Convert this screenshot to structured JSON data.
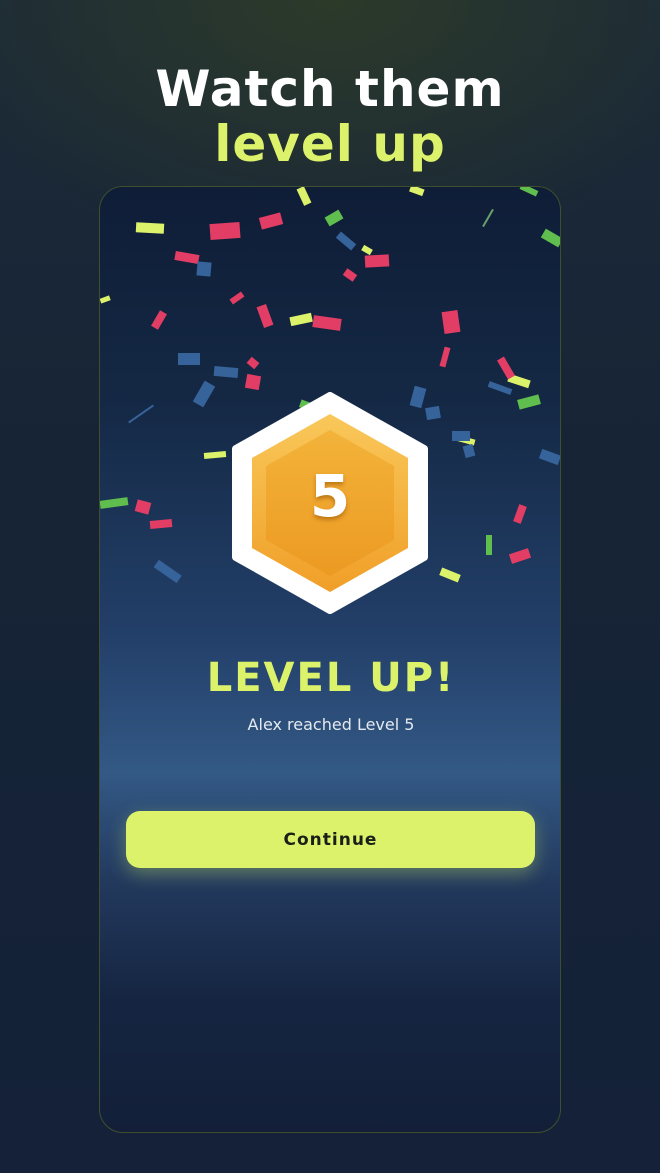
{
  "promo": {
    "headline_line1": "Watch them",
    "headline_line2": "level up"
  },
  "level_up_screen": {
    "level_number": "5",
    "title": "LEVEL UP!",
    "subtitle": "Alex reached Level 5",
    "continue_label": "Continue"
  },
  "colors": {
    "accent": "#dcf26a",
    "badge_gold": "#f2a52e",
    "confetti_red": "#e23d64",
    "confetti_blue": "#36639a",
    "confetti_green": "#5fbe4e"
  }
}
